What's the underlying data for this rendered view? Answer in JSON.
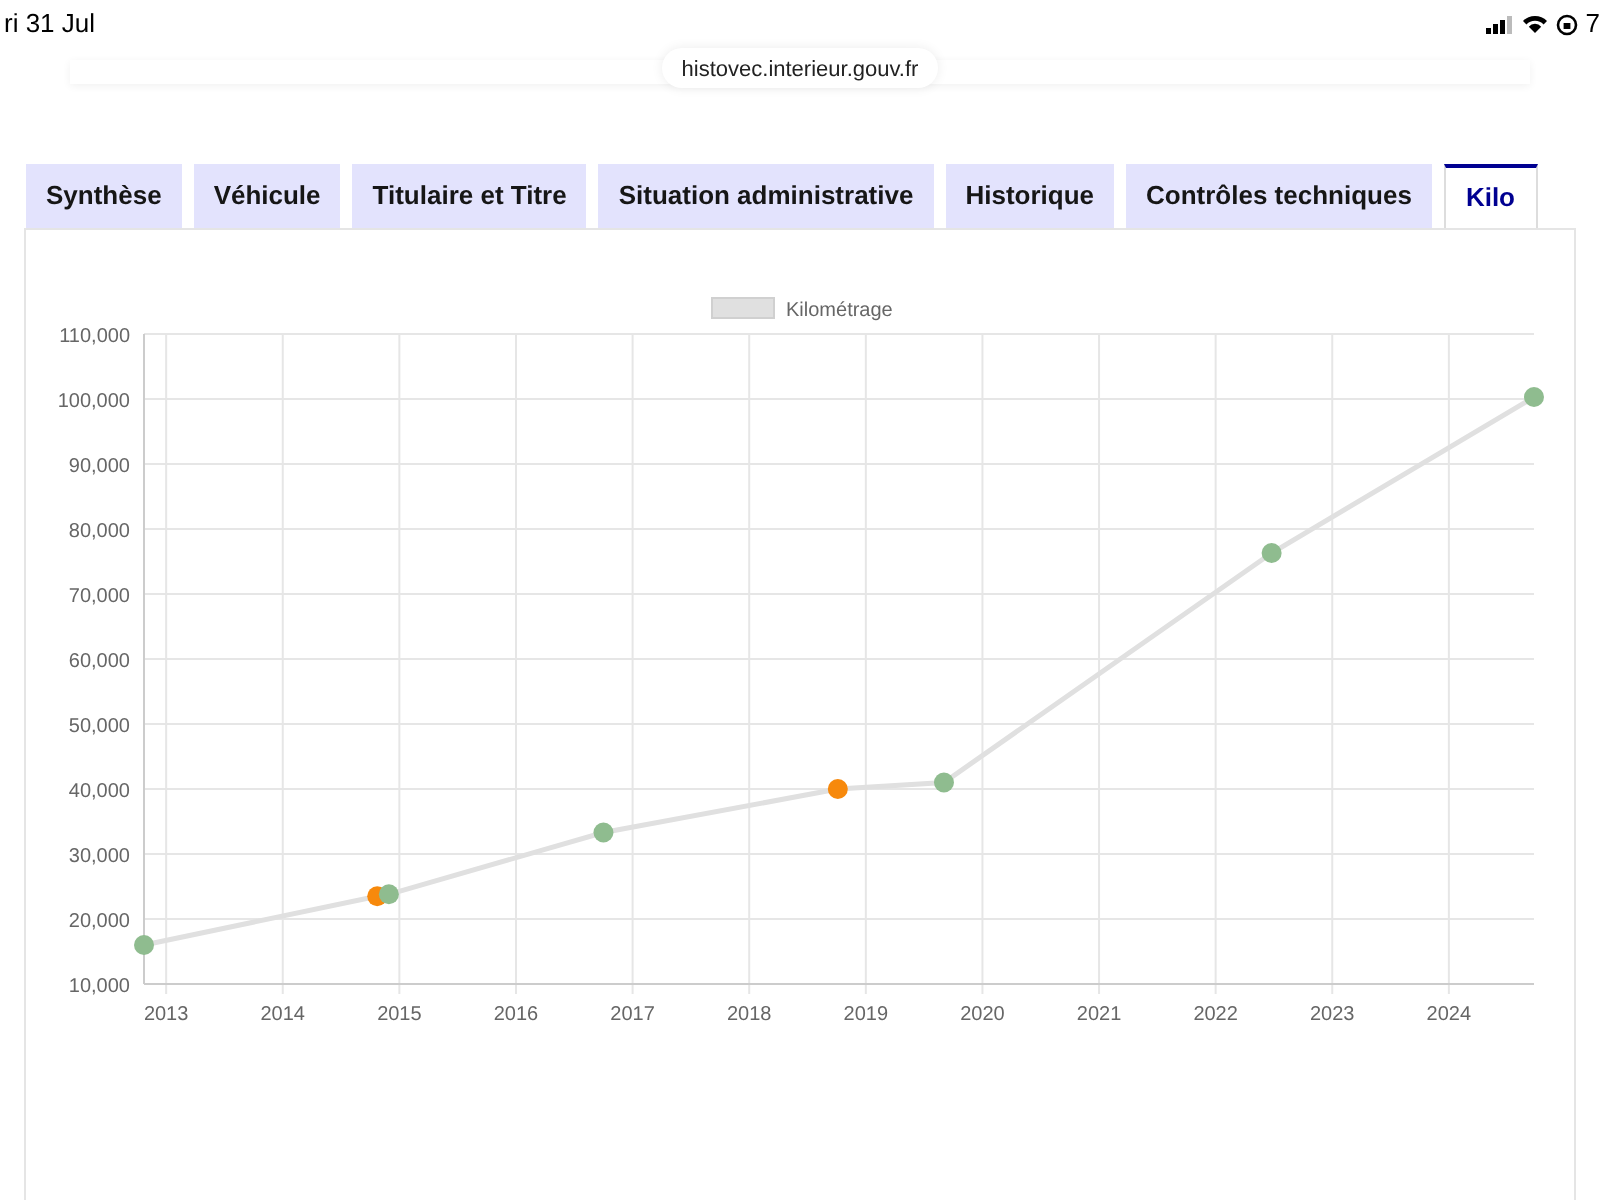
{
  "status_bar": {
    "date": "ri 31 Jul",
    "time": "7"
  },
  "address_bar": {
    "url": "histovec.interieur.gouv.fr"
  },
  "tabs": [
    {
      "label": "Synthèse",
      "selected": false
    },
    {
      "label": "Véhicule",
      "selected": false
    },
    {
      "label": "Titulaire et Titre",
      "selected": false
    },
    {
      "label": "Situation administrative",
      "selected": false
    },
    {
      "label": "Historique",
      "selected": false
    },
    {
      "label": "Contrôles techniques",
      "selected": false
    },
    {
      "label": "Kilo",
      "selected": true
    }
  ],
  "chart_data": {
    "type": "line",
    "x": [
      2012.81,
      2014.81,
      2014.91,
      2016.75,
      2018.76,
      2019.67,
      2022.48,
      2024.73
    ],
    "series": [
      {
        "name": "Kilométrage",
        "color": "#e0e0e0",
        "values": [
          16000,
          23500,
          23800,
          33300,
          40000,
          41000,
          76300,
          100300
        ],
        "marker": "circle"
      }
    ],
    "grid": true,
    "xlim": [
      2012.81,
      2024.73
    ],
    "ylim": [
      10000,
      110000
    ],
    "xticks": [
      2013,
      2014,
      2015,
      2016,
      2017,
      2018,
      2019,
      2020,
      2021,
      2022,
      2023,
      2024
    ],
    "yticks": [
      {
        "value": 10000,
        "label": "10,000"
      },
      {
        "value": 20000,
        "label": "20,000"
      },
      {
        "value": 30000,
        "label": "30,000"
      },
      {
        "value": 40000,
        "label": "40,000"
      },
      {
        "value": 50000,
        "label": "50,000"
      },
      {
        "value": 60000,
        "label": "60,000"
      },
      {
        "value": 70000,
        "label": "70,000"
      },
      {
        "value": 80000,
        "label": "80,000"
      },
      {
        "value": 90000,
        "label": "90,000"
      },
      {
        "value": 100000,
        "label": "100,000"
      },
      {
        "value": 110000,
        "label": "110,000"
      }
    ]
  },
  "chart_points": [
    {
      "color": "#8fbc8f"
    },
    {
      "color": "#f7890c"
    },
    {
      "color": "#8fbc8f"
    },
    {
      "color": "#8fbc8f"
    },
    {
      "color": "#f7890c"
    },
    {
      "color": "#8fbc8f"
    },
    {
      "color": "#8fbc8f"
    },
    {
      "color": "#8fbc8f"
    }
  ]
}
